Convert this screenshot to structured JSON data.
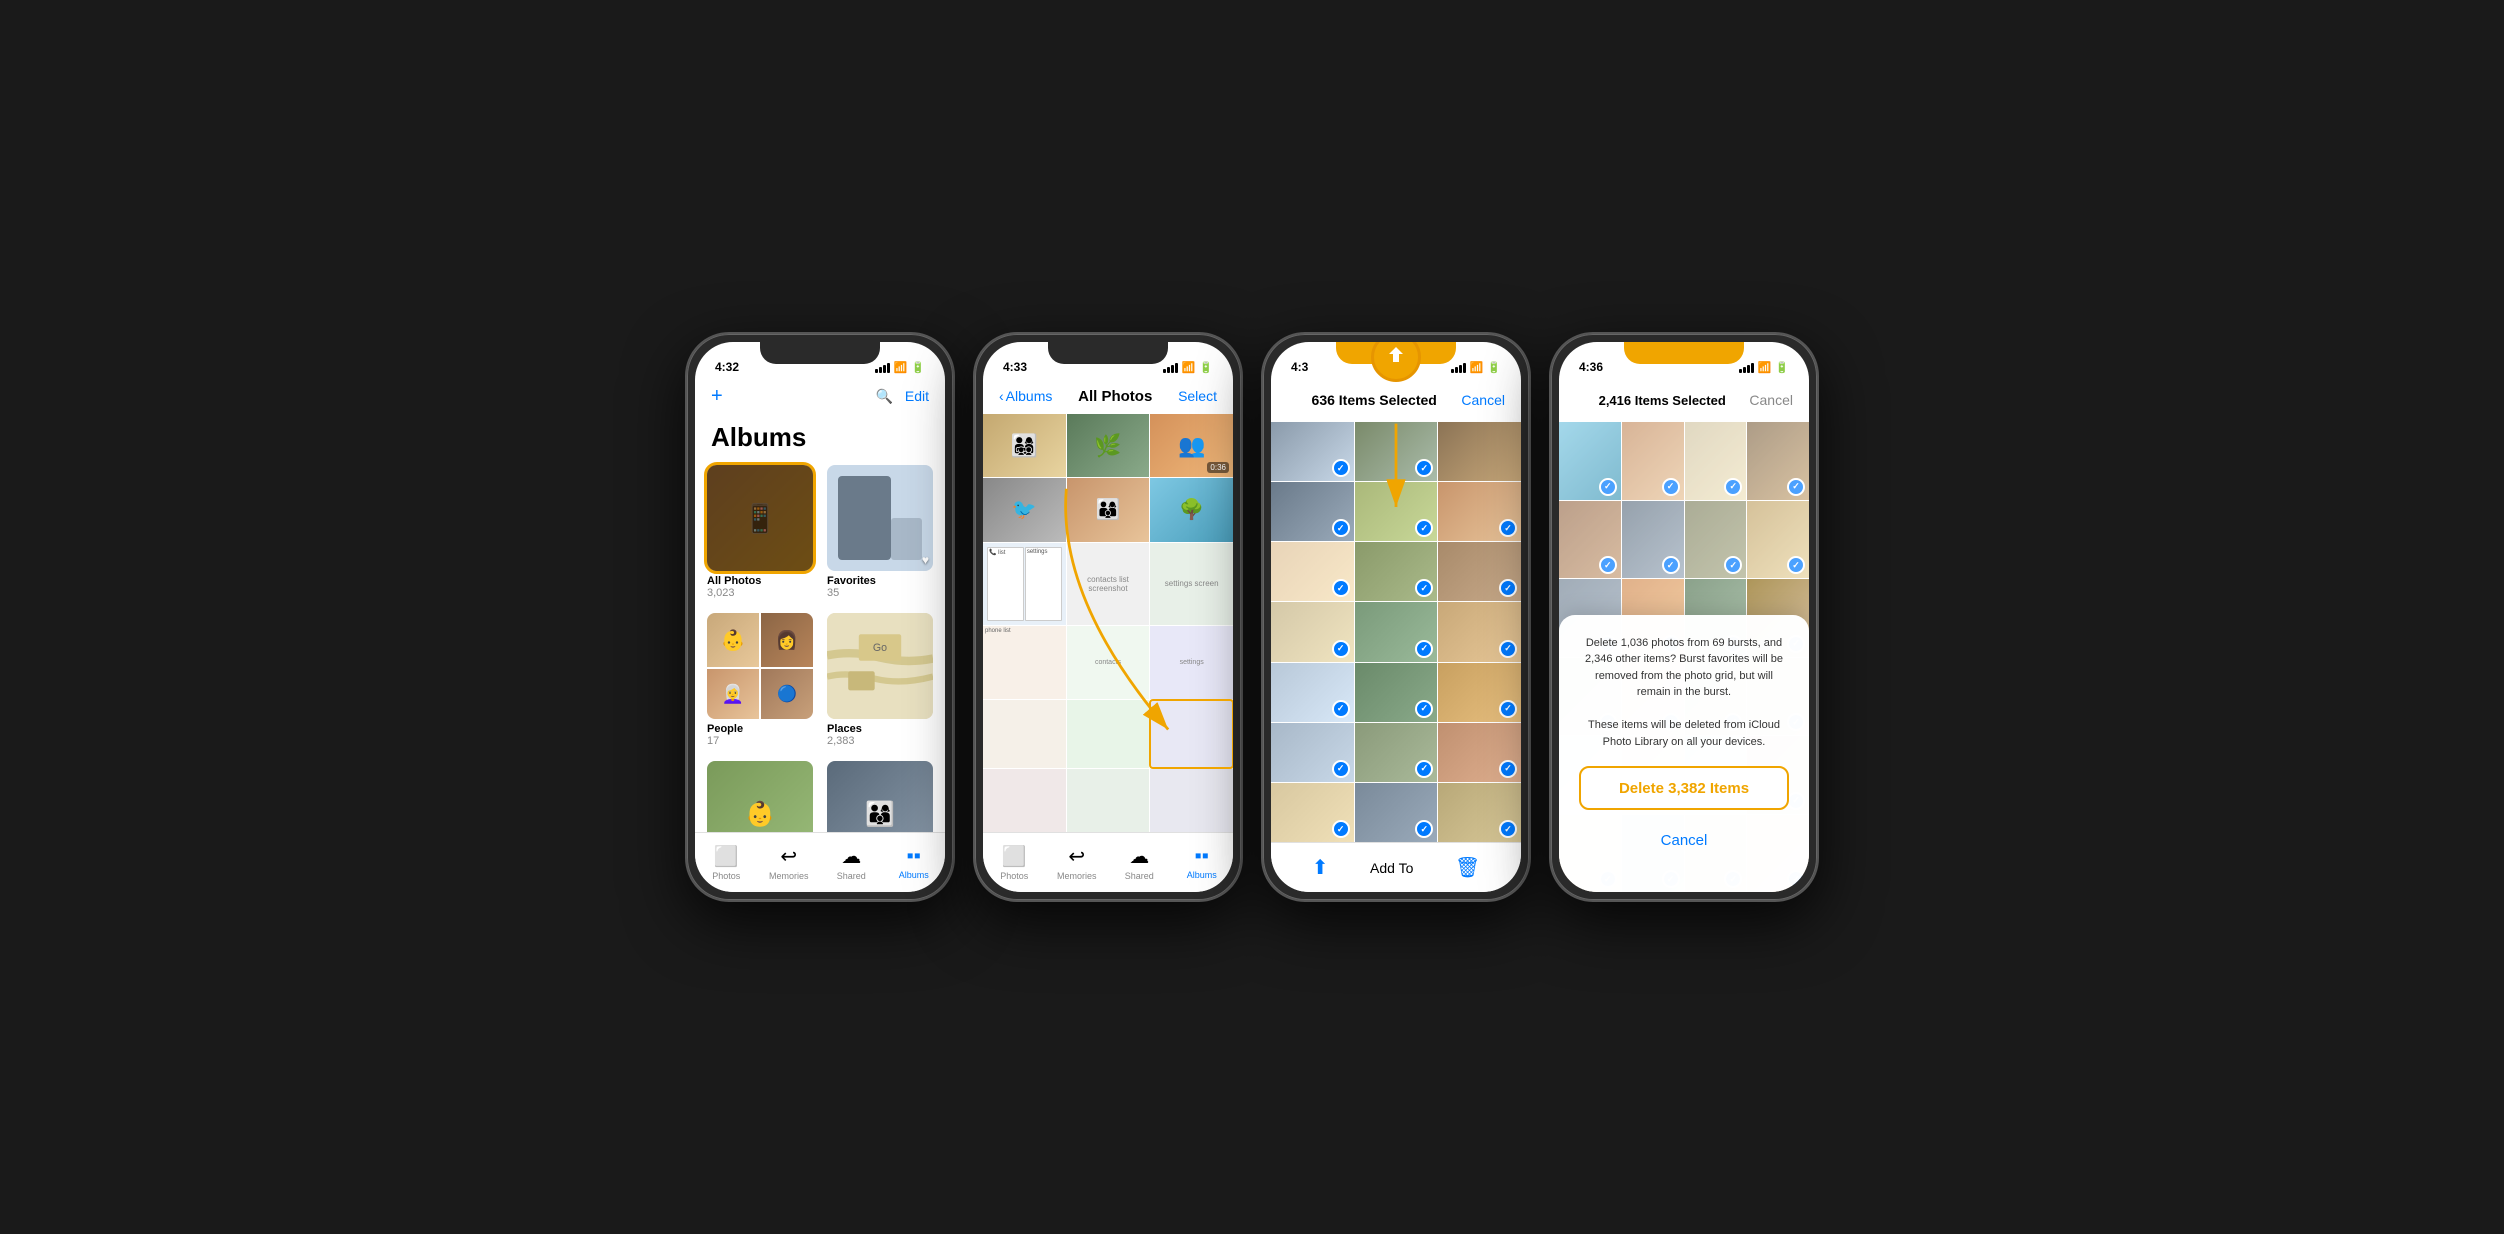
{
  "phone1": {
    "status": {
      "time": "4:32",
      "signal": true,
      "wifi": true,
      "battery": true
    },
    "header": {
      "add_btn": "+",
      "search_btn": "🔍",
      "edit_btn": "Edit",
      "title": "Albums"
    },
    "albums": [
      {
        "name": "All Photos",
        "count": "3,023",
        "highlighted": true
      },
      {
        "name": "Favorites",
        "count": "35"
      },
      {
        "name": "People",
        "count": "17"
      },
      {
        "name": "Places",
        "count": "2,383"
      },
      {
        "name": "",
        "count": ""
      },
      {
        "name": "",
        "count": ""
      }
    ],
    "tabs": [
      {
        "label": "Photos",
        "icon": "photos",
        "active": false
      },
      {
        "label": "Memories",
        "icon": "memories",
        "active": false
      },
      {
        "label": "Shared",
        "icon": "shared",
        "active": false
      },
      {
        "label": "Albums",
        "icon": "albums",
        "active": true
      }
    ]
  },
  "phone2": {
    "status": {
      "time": "4:33"
    },
    "nav": {
      "back_label": "Albums",
      "title": "All Photos",
      "select_btn": "Select"
    },
    "tabs": [
      {
        "label": "Photos",
        "active": false
      },
      {
        "label": "Memories",
        "active": false
      },
      {
        "label": "Shared",
        "active": false
      },
      {
        "label": "Albums",
        "active": true
      }
    ]
  },
  "phone3": {
    "status": {
      "time": "4:3"
    },
    "header": {
      "items_selected": "636 Items Selected",
      "cancel_btn": "Cancel"
    },
    "action_bar": {
      "share_btn": "share",
      "add_to_label": "Add To",
      "delete_btn": "delete"
    }
  },
  "phone4": {
    "status": {
      "time": "4:36"
    },
    "header": {
      "items_selected": "2,416 Items Selected",
      "cancel_btn": "Cancel"
    },
    "dialog": {
      "message": "Delete 1,036 photos from 69 bursts, and 2,346 other items? Burst favorites will be removed from the photo grid, but will remain in the burst.\n\nThese items will be deleted from iCloud Photo Library on all your devices.",
      "delete_btn": "Delete 3,382 Items",
      "cancel_btn": "Cancel"
    }
  }
}
